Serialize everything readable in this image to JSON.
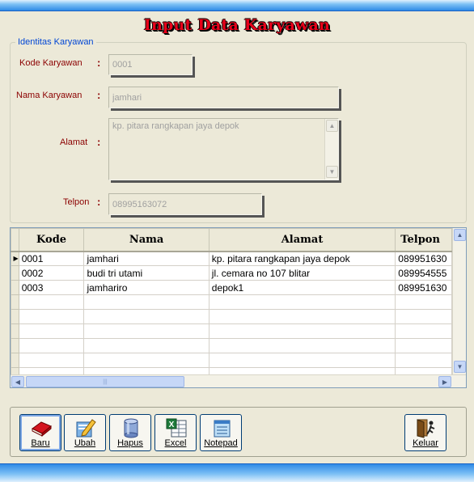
{
  "title": "Input Data Karyawan",
  "group": {
    "legend": "Identitas Karyawan",
    "fields": {
      "kode": {
        "label": "Kode Karyawan",
        "value": "0001"
      },
      "nama": {
        "label": "Nama Karyawan",
        "value": "jamhari"
      },
      "alamat": {
        "label": "Alamat",
        "value": "kp. pitara rangkapan jaya depok"
      },
      "telpon": {
        "label": "Telpon",
        "value": "08995163072"
      }
    },
    "colon": ":"
  },
  "grid": {
    "columns": [
      "Kode",
      "Nama",
      "Alamat",
      "Telpon"
    ],
    "rows": [
      [
        "0001",
        "jamhari",
        "kp. pitara rangkapan jaya depok",
        "089951630"
      ],
      [
        "0002",
        "budi tri utami",
        "jl. cemara no 107 blitar",
        "089954555"
      ],
      [
        "0003",
        "jamhariro",
        "depok1",
        "089951630"
      ]
    ],
    "current_row_indicator": "▶"
  },
  "toolbar": {
    "baru": "Baru",
    "ubah": "Ubah",
    "hapus": "Hapus",
    "excel": "Excel",
    "notepad": "Notepad",
    "keluar": "Keluar"
  },
  "icons": {
    "baru": "book-icon",
    "ubah": "edit-pencil-icon",
    "hapus": "cylinder-icon",
    "excel": "excel-icon",
    "notepad": "notepad-icon",
    "keluar": "exit-door-icon"
  },
  "colors": {
    "title": "#e8001a",
    "label": "#8b0000",
    "legend": "#0046d5",
    "window": "#ece9d8",
    "accent_bar": "#2f8ae6"
  }
}
